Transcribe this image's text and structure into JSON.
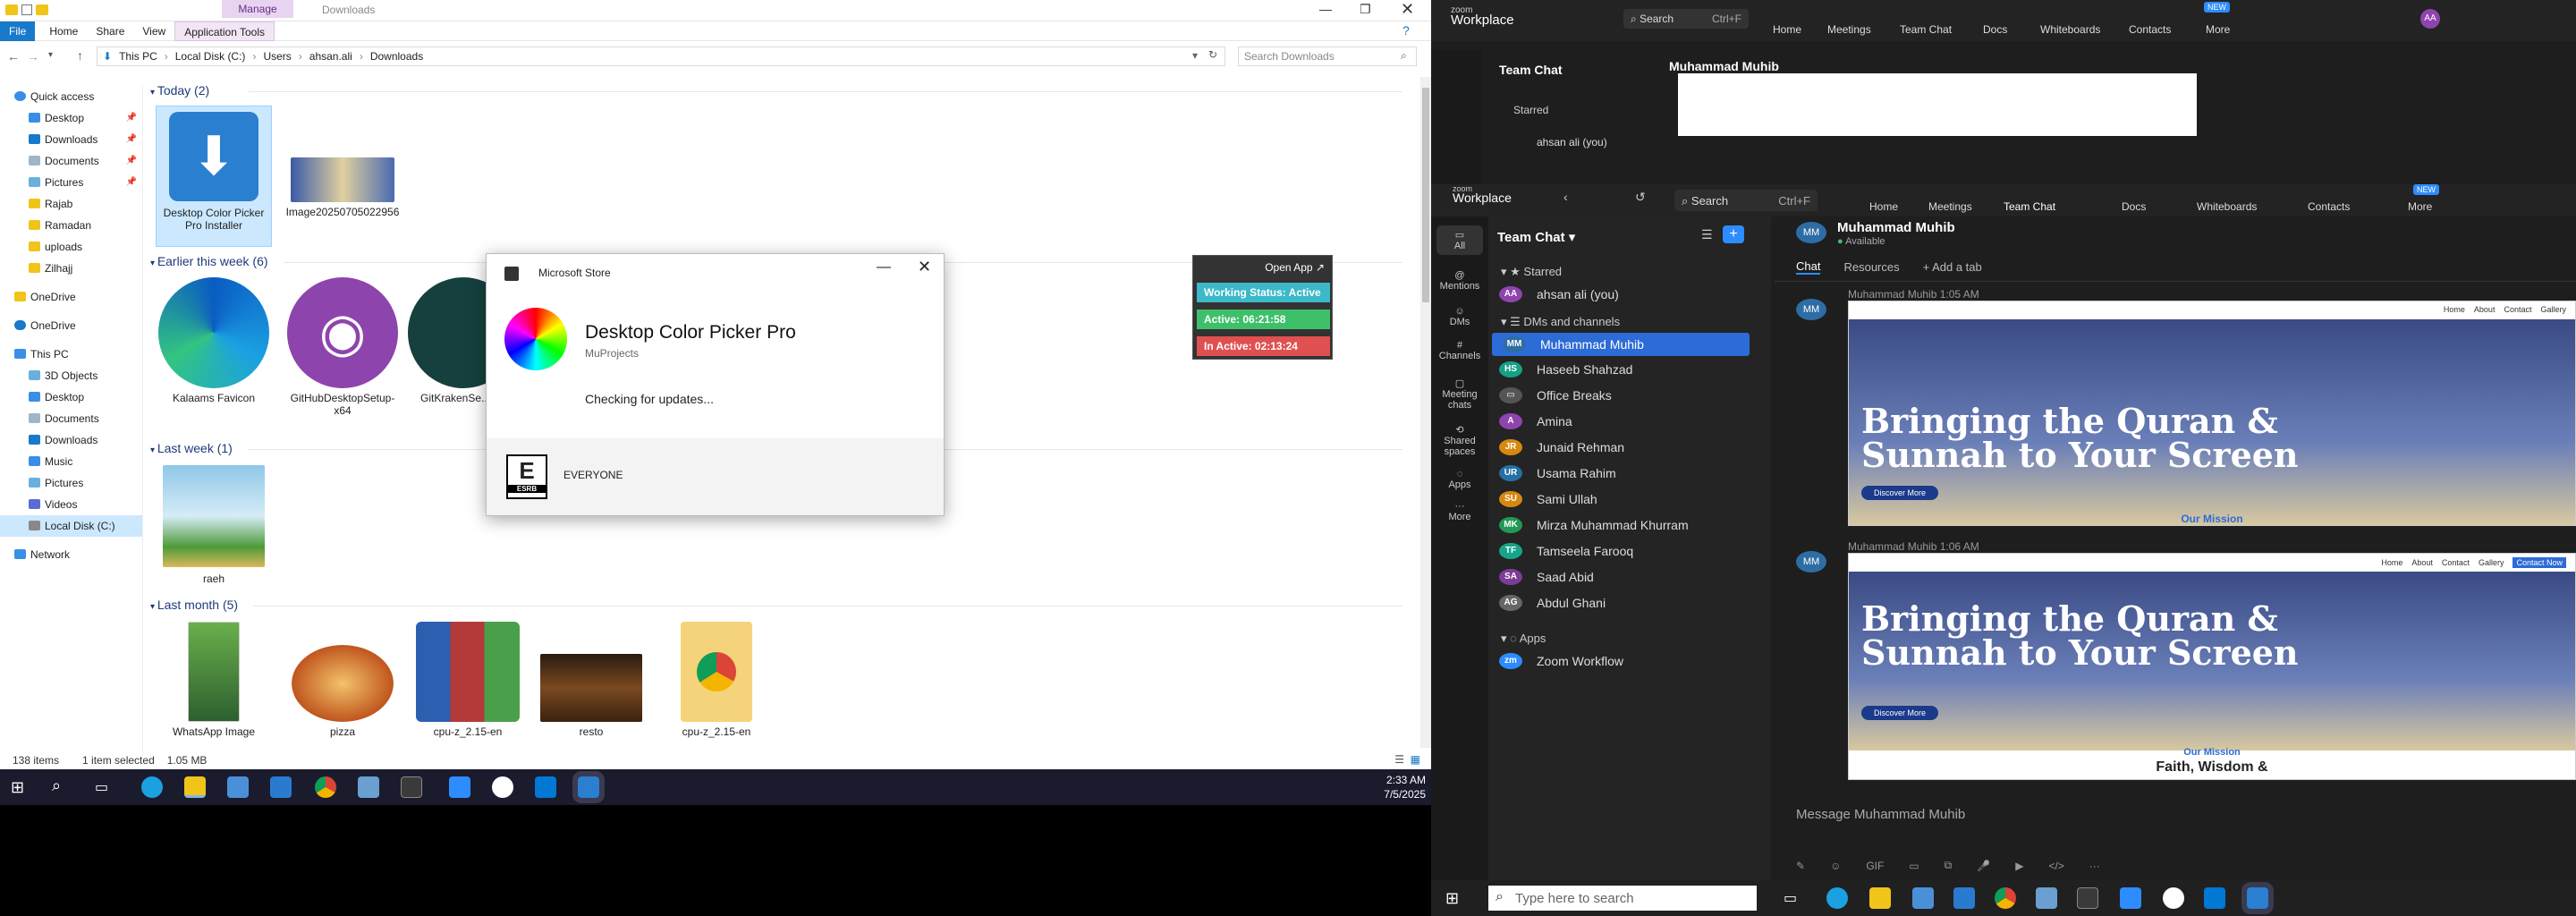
{
  "explorer": {
    "manage_tab": "Manage",
    "downloads_title": "Downloads",
    "tabs": [
      "File",
      "Home",
      "Share",
      "View",
      "Application Tools"
    ],
    "breadcrumb": [
      "This PC",
      "Local Disk (C:)",
      "Users",
      "ahsan.ali",
      "Downloads"
    ],
    "search_placeholder": "Search Downloads",
    "nav": {
      "quick_access": "Quick access",
      "pinned": [
        "Desktop",
        "Downloads",
        "Documents",
        "Pictures"
      ],
      "folders": [
        "Rajab",
        "Ramadan",
        "uploads",
        "Zilhajj"
      ],
      "onedrive1": "OneDrive",
      "onedrive2": "OneDrive",
      "this_pc": "This PC",
      "pc_items": [
        "3D Objects",
        "Desktop",
        "Documents",
        "Downloads",
        "Music",
        "Pictures",
        "Videos",
        "Local Disk (C:)"
      ],
      "network": "Network"
    },
    "groups": {
      "today": "Today (2)",
      "week": "Earlier this week (6)",
      "last_week": "Last week (1)",
      "last_month": "Last month (5)"
    },
    "files": {
      "f1": "Desktop Color Picker Pro Installer",
      "f2": "Image20250705022956",
      "f3": "Kalaams Favicon",
      "f4": "GitHubDesktopSetup-x64",
      "f5": "GitKrakenSe...",
      "f6": "raeh",
      "f7": "WhatsApp Image",
      "f8": "pizza",
      "f9": "cpu-z_2.15-en",
      "f10": "resto",
      "f11": "cpu-z_2.15-en"
    },
    "status": {
      "items": "138 items",
      "selected": "1 item selected",
      "size": "1.05 MB"
    }
  },
  "store": {
    "title": "Microsoft Store",
    "app_name": "Desktop Color Picker Pro",
    "publisher": "MuProjects",
    "status": "Checking for updates...",
    "rating": "EVERYONE",
    "esrb": "E",
    "esrb_label": "ESRB"
  },
  "widget": {
    "open_app": "Open App ↗",
    "working": "Working Status: Active",
    "active": "Active: 06:21:58",
    "inactive": "In Active: 02:13:24"
  },
  "clock": {
    "time": "2:33 AM",
    "date": "7/5/2025"
  },
  "zoom": {
    "brand_top": "zoom",
    "brand_bottom": "Workplace",
    "search": "Search",
    "shortcut": "Ctrl+F",
    "nav": [
      "Home",
      "Meetings",
      "Team Chat",
      "Docs",
      "Whiteboards",
      "Contacts",
      "More"
    ],
    "new_badge": "NEW",
    "rail": [
      "All",
      "Mentions",
      "DMs",
      "Channels",
      "Meeting chats",
      "Shared spaces",
      "Apps",
      "More"
    ],
    "team_chat": "Team Chat",
    "starred": "Starred",
    "dms_channels": "DMs and channels",
    "apps": "Apps",
    "contacts": [
      {
        "init": "AA",
        "name": "ahsan ali (you)",
        "color": "#8e44ad"
      },
      {
        "init": "MM",
        "name": "Muhammad Muhib",
        "color": "#2e6da4"
      },
      {
        "init": "HS",
        "name": "Haseeb Shahzad",
        "color": "#16a085"
      },
      {
        "init": "",
        "name": "Office Breaks",
        "color": "#555"
      },
      {
        "init": "A",
        "name": "Amina",
        "color": "#8e44ad"
      },
      {
        "init": "JR",
        "name": "Junaid Rehman",
        "color": "#d68910"
      },
      {
        "init": "UR",
        "name": "Usama Rahim",
        "color": "#2471a3"
      },
      {
        "init": "SU",
        "name": "Sami Ullah",
        "color": "#d68910"
      },
      {
        "init": "MK",
        "name": "Mirza Muhammad Khurram",
        "color": "#229954"
      },
      {
        "init": "TF",
        "name": "Tamseela Farooq",
        "color": "#17a589"
      },
      {
        "init": "SA",
        "name": "Saad Abid",
        "color": "#7d3c98"
      },
      {
        "init": "AG",
        "name": "Abdul Ghani",
        "color": "#666"
      }
    ],
    "zoom_workflow": "Zoom Workflow",
    "contact_name": "Muhammad Muhib",
    "contact_status": "Available",
    "chat_tabs": [
      "Chat",
      "Resources",
      "+ Add a tab"
    ],
    "msg1_meta": "Muhammad Muhib  1:05 AM",
    "msg2_meta": "Muhammad Muhib  1:06 AM",
    "web_nav": [
      "Home",
      "About",
      "Contact",
      "Gallery",
      "Contact Now"
    ],
    "hero_title": "Bringing the Quran & Sunnah to Your Screen",
    "hero_btn": "Discover More",
    "mission": "Our Mission",
    "faith": "Faith, Wisdom &",
    "compose": "Message Muhammad Muhib",
    "gif": "GIF",
    "taskbar_search": "Type here to search"
  }
}
